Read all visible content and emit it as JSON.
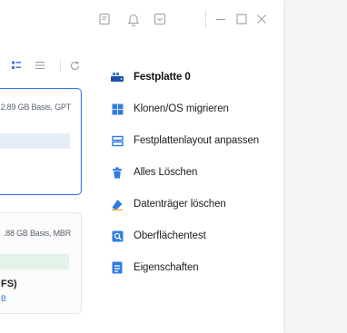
{
  "titlebar": {
    "icons": [
      "feedback-icon",
      "notification-bell-icon",
      "dropdown-menu-icon",
      "minimize-icon",
      "maximize-icon",
      "close-icon"
    ]
  },
  "view_toolbar": {
    "icons": [
      "grid-view-icon",
      "list-view-icon",
      "refresh-icon"
    ]
  },
  "disks": [
    {
      "info": "2.89 GB Basis, GPT",
      "bar_color": "#e6ecf7",
      "selected": true
    },
    {
      "info": ".88 GB Basis, MBR",
      "bar_color": "#e4f3e8",
      "selected": false,
      "partition_label": "FS)",
      "partition_sub": "B"
    }
  ],
  "menu": {
    "header": "Festplatte 0",
    "items": [
      {
        "label": "Klonen/OS  migrieren",
        "icon": "windows-logo-icon"
      },
      {
        "label": "Festplattenlayout anpassen",
        "icon": "disk-layout-icon"
      },
      {
        "label": "Alles Löschen",
        "icon": "trash-icon"
      },
      {
        "label": "Datenträger löschen",
        "icon": "eraser-icon"
      },
      {
        "label": "Oberflächentest",
        "icon": "surface-test-icon"
      },
      {
        "label": "Eigenschaften",
        "icon": "properties-icon"
      }
    ]
  },
  "colors": {
    "accent": "#2f7de1",
    "selected_border": "#3a78e6",
    "background": "#f4f4f4"
  }
}
